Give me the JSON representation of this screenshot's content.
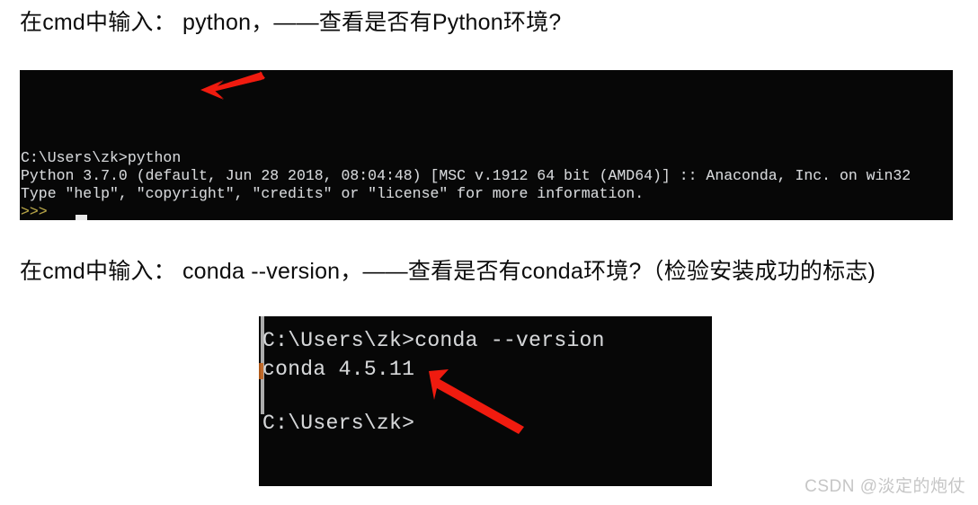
{
  "page": {
    "background_color": "#ffffff",
    "watermark": "CSDN @淡定的炮仗"
  },
  "headings": {
    "python_step": "在cmd中输入： python，——查看是否有Python环境?",
    "conda_step": "在cmd中输入： conda --version，——查看是否有conda环境?（检验安装成功的标志)"
  },
  "terminals": [
    {
      "id": "terminal-python",
      "background_color": "#070707",
      "text_color": "#d6d6d6",
      "prompt_color": "#b8a33c",
      "lines": [
        "C:\\Users\\zk>python",
        "Python 3.7.0 (default, Jun 28 2018, 08:04:48) [MSC v.1912 64 bit (AMD64)] :: Anaconda, Inc. on win32",
        "Type \"help\", \"copyright\", \"credits\" or \"license\" for more information.",
        ">>>"
      ],
      "cursor": "block-cursor"
    },
    {
      "id": "terminal-conda",
      "background_color": "#070707",
      "text_color": "#d6d6d6",
      "lines": [
        "C:\\Users\\zk>conda --version",
        "conda 4.5.11",
        "C:\\Users\\zk>"
      ]
    }
  ],
  "annotations": [
    {
      "id": "arrow-python",
      "type": "arrow",
      "color": "#f01b0f",
      "points_to": "python command",
      "direction": "left"
    },
    {
      "id": "arrow-conda",
      "type": "arrow",
      "color": "#f01b0f",
      "points_to": "conda 4.5.11 version output",
      "direction": "up-left"
    }
  ]
}
